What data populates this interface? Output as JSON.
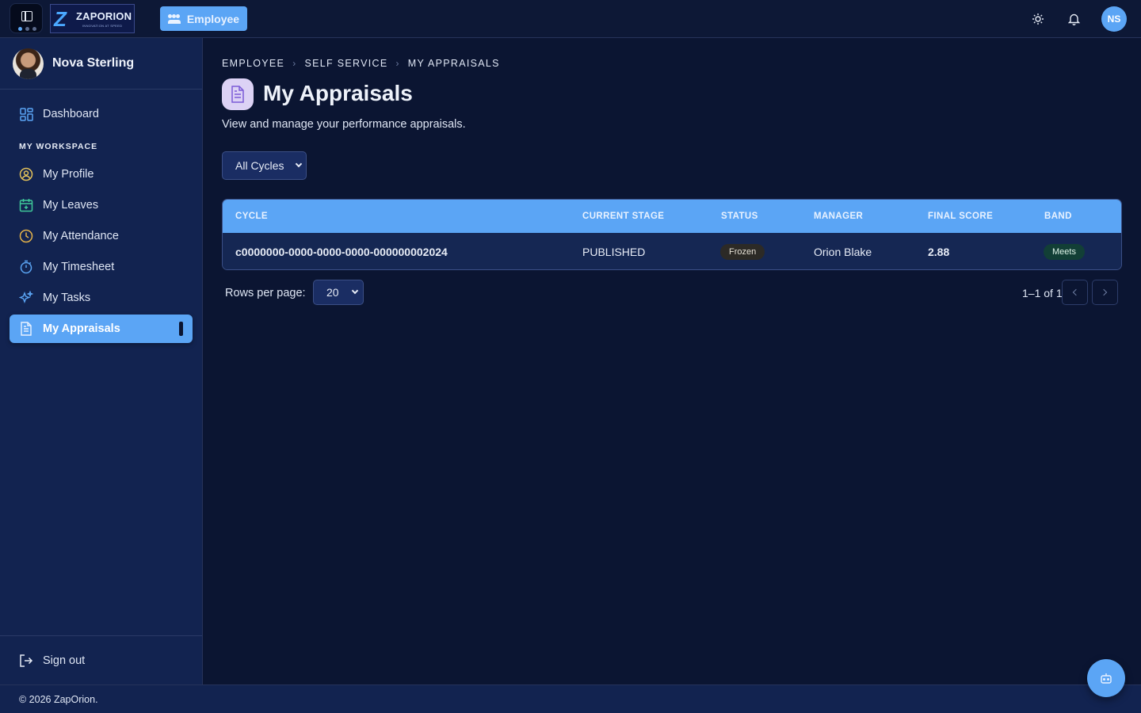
{
  "header": {
    "logo_brand": "ZAPORION",
    "logo_tagline": "INNOVATION AT SPEED",
    "role_label": "Employee",
    "avatar_initials": "NS",
    "icons": [
      "panel-toggle-icon",
      "sun-icon",
      "bell-icon",
      "people-icon"
    ]
  },
  "sidebar": {
    "user_name": "Nova Sterling",
    "dashboard_label": "Dashboard",
    "section_label": "MY WORKSPACE",
    "items": [
      {
        "label": "My Profile",
        "icon": "user-circle-icon"
      },
      {
        "label": "My Leaves",
        "icon": "calendar-plus-icon"
      },
      {
        "label": "My Attendance",
        "icon": "clock-icon"
      },
      {
        "label": "My Timesheet",
        "icon": "stopwatch-icon"
      },
      {
        "label": "My Tasks",
        "icon": "sparkles-icon"
      },
      {
        "label": "My Appraisals",
        "icon": "document-icon",
        "active": true
      }
    ],
    "signout_label": "Sign out"
  },
  "breadcrumb": [
    "EMPLOYEE",
    "SELF SERVICE",
    "MY APPRAISALS"
  ],
  "page": {
    "title": "My Appraisals",
    "description": "View and manage your performance appraisals.",
    "cycle_filter": "All Cycles"
  },
  "table": {
    "columns": [
      "CYCLE",
      "CURRENT STAGE",
      "STATUS",
      "MANAGER",
      "FINAL SCORE",
      "BAND"
    ],
    "rows": [
      {
        "cycle": "c0000000-0000-0000-0000-000000002024",
        "stage": "PUBLISHED",
        "status": "Frozen",
        "manager": "Orion Blake",
        "score": "2.88",
        "band": "Meets"
      }
    ]
  },
  "pagination": {
    "rows_per_page_label": "Rows per page:",
    "rows_per_page_value": "20",
    "range_text": "1–1 of 1"
  },
  "footer": {
    "copyright": "© 2026 ZapOrion."
  },
  "colors": {
    "accent": "#5ba5f5",
    "background": "#0b1532",
    "sidebar": "#122350",
    "frozen_badge": "#2c2a26",
    "meets_badge": "#123f36"
  }
}
